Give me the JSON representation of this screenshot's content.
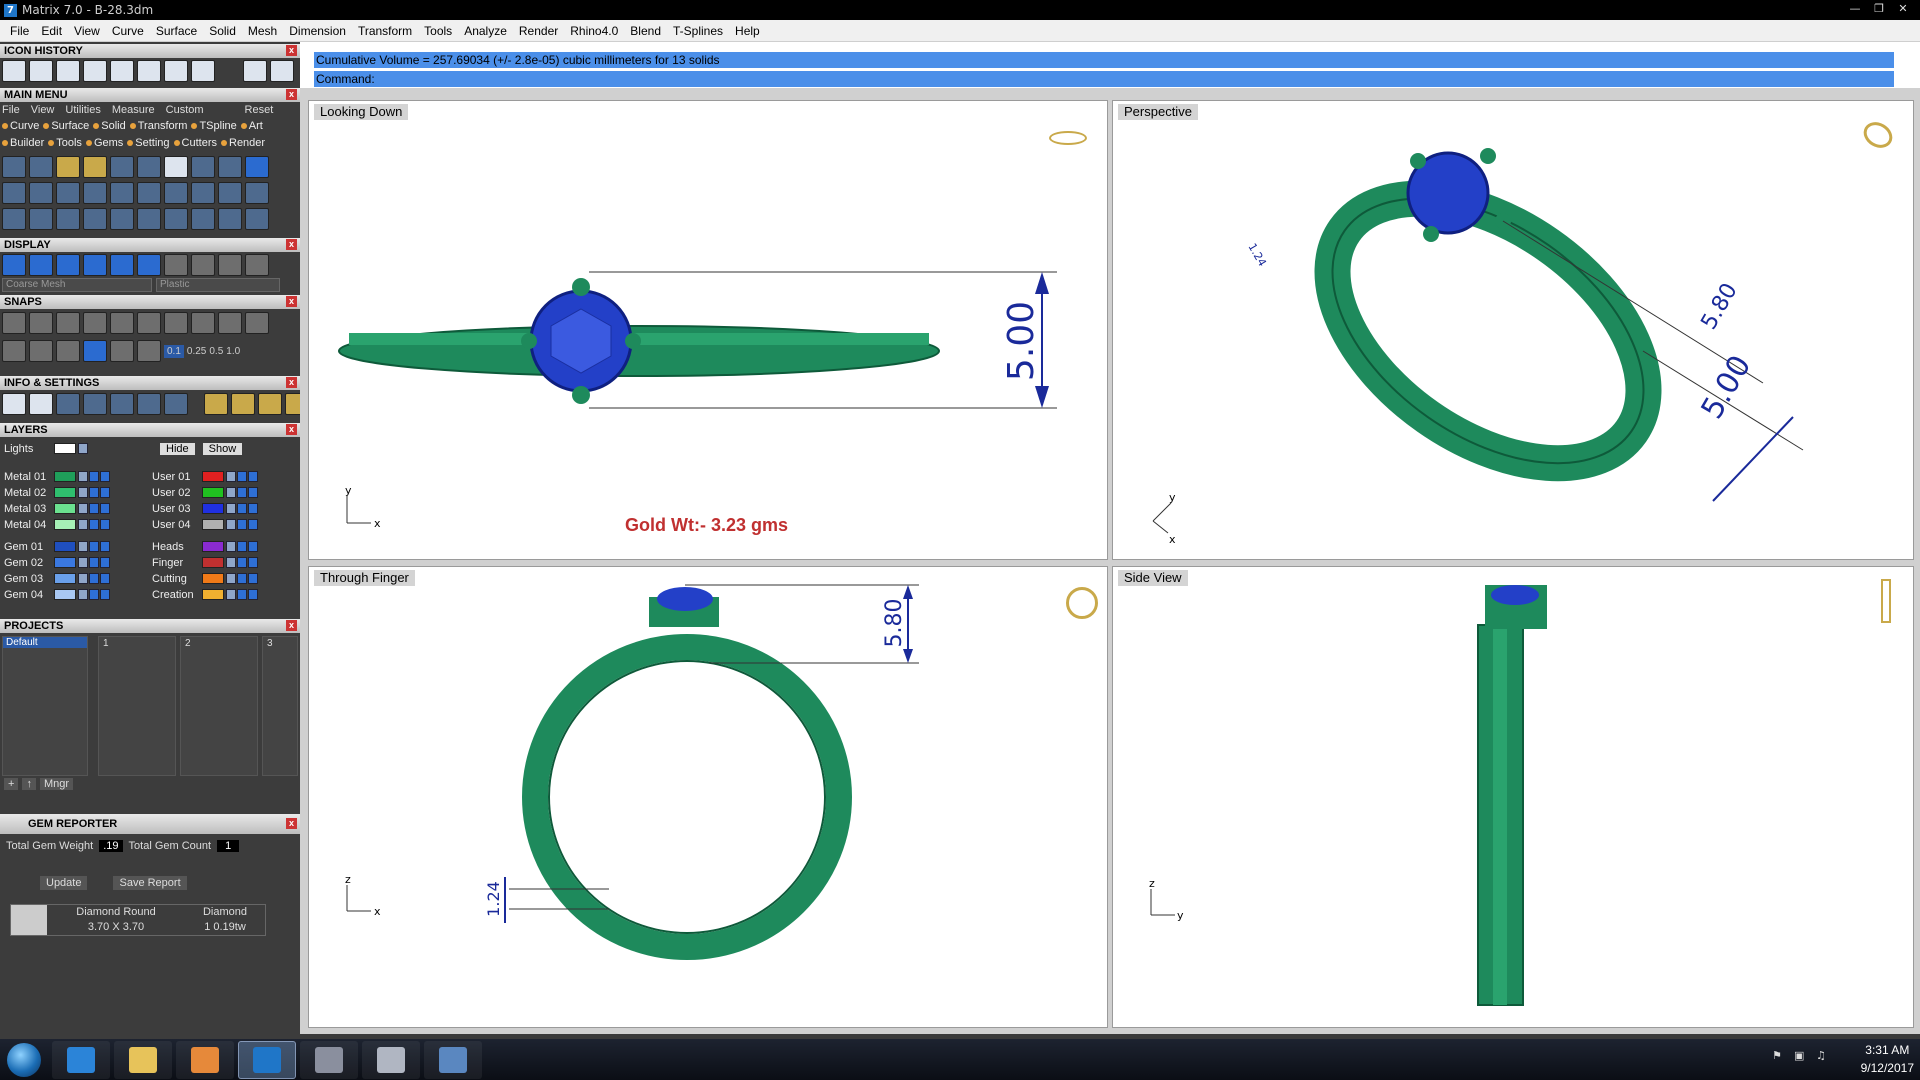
{
  "window": {
    "title": "Matrix 7.0 - B-28.3dm"
  },
  "menubar": [
    "File",
    "Edit",
    "View",
    "Curve",
    "Surface",
    "Solid",
    "Mesh",
    "Dimension",
    "Transform",
    "Tools",
    "Analyze",
    "Render",
    "Rhino4.0",
    "Blend",
    "T-Splines",
    "Help"
  ],
  "left_panel": {
    "icon_history": {
      "title": "ICON HISTORY"
    },
    "main_menu": {
      "title": "MAIN MENU",
      "submenu": [
        "File",
        "View",
        "Utilities",
        "Measure",
        "Custom"
      ],
      "reset": "Reset",
      "categories_row1": [
        "Curve",
        "Surface",
        "Solid",
        "Transform",
        "TSpline",
        "Art"
      ],
      "categories_row2": [
        "Builder",
        "Tools",
        "Gems",
        "Setting",
        "Cutters",
        "Render"
      ]
    },
    "display": {
      "title": "DISPLAY",
      "mesh": "Coarse Mesh",
      "material": "Plastic"
    },
    "snaps": {
      "title": "SNAPS",
      "values": [
        "0.1",
        "0.25",
        "0.5",
        "1.0"
      ]
    },
    "info_settings": {
      "title": "INFO & SETTINGS"
    },
    "layers": {
      "title": "LAYERS",
      "lights": "Lights",
      "hide": "Hide",
      "show": "Show",
      "left": [
        {
          "name": "Metal 01",
          "color": "#1f9e5a"
        },
        {
          "name": "Metal 02",
          "color": "#2fbf6e"
        },
        {
          "name": "Metal 03",
          "color": "#6be08f"
        },
        {
          "name": "Metal 04",
          "color": "#a6f0b6"
        },
        {
          "name": "Gem 01",
          "color": "#1f4fbf"
        },
        {
          "name": "Gem 02",
          "color": "#3a78e0"
        },
        {
          "name": "Gem 03",
          "color": "#6aa0ea"
        },
        {
          "name": "Gem 04",
          "color": "#a9c8f3"
        }
      ],
      "right": [
        {
          "name": "User 01",
          "color": "#e02020"
        },
        {
          "name": "User 02",
          "color": "#20c020"
        },
        {
          "name": "User 03",
          "color": "#2030e0"
        },
        {
          "name": "User 04",
          "color": "#b0b0b0"
        },
        {
          "name": "Heads",
          "color": "#8a2bd0"
        },
        {
          "name": "Finger",
          "color": "#c03030"
        },
        {
          "name": "Cutting",
          "color": "#f07a18"
        },
        {
          "name": "Creation",
          "color": "#f0b030"
        }
      ]
    },
    "projects": {
      "title": "PROJECTS",
      "default": "Default",
      "slots": [
        "1",
        "2",
        "3"
      ],
      "mngr": "Mngr"
    },
    "gem_reporter": {
      "title": "GEM REPORTER",
      "total_weight_label": "Total Gem Weight",
      "total_weight": ".19",
      "total_count_label": "Total Gem Count",
      "total_count": "1",
      "update": "Update",
      "save_report": "Save Report",
      "gem_shape": "Diamond Round",
      "gem_size": "3.70 X 3.70",
      "gem_type": "Diamond",
      "gem_qty": "1",
      "gem_weight": "0.19tw"
    }
  },
  "command": {
    "line1": "Cumulative Volume = 257.69034 (+/- 2.8e-05) cubic millimeters for 13 solids",
    "line2": "Command:"
  },
  "viewports": {
    "top_left": {
      "title": "Looking Down",
      "dimension": "5.00",
      "gold_weight": "Gold Wt:- 3.23 gms",
      "axis_v": "y",
      "axis_h": "x"
    },
    "top_right": {
      "title": "Perspective",
      "dim1": "5.80",
      "dim2": "5.00",
      "dim3": "1.24",
      "axis_v": "y",
      "axis_h": "x"
    },
    "bottom_left": {
      "title": "Through Finger",
      "dimension_top": "5.80",
      "dimension_bottom": "1.24",
      "axis_v": "z",
      "axis_h": "x"
    },
    "bottom_right": {
      "title": "Side View",
      "axis_v": "z",
      "axis_h": "y"
    }
  },
  "taskbar": {
    "time": "3:31 AM",
    "date": "9/12/2017"
  },
  "colors": {
    "metal": "#1e8a5c",
    "gem": "#2340c8",
    "dimension": "#1a2a9a",
    "gold_text": "#c03030"
  }
}
